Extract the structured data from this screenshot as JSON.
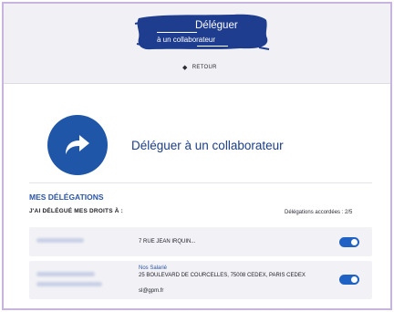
{
  "header": {
    "title_line1": "Déléguer",
    "title_line2": "à un collaborateur",
    "back_label": "RETOUR",
    "brush_color": "#1e3d8f",
    "background_color": "#f1f1f5"
  },
  "hero": {
    "icon": "forward-arrow-icon",
    "title": "Déléguer à un collaborateur",
    "accent_color": "#1f56a8"
  },
  "delegations": {
    "section_title": "MES DÉLÉGATIONS",
    "subtitle": "J'AI DÉLÉGUÉ MES DROITS À :",
    "count_label": "Délégations accordées : 2/5",
    "items": [
      {
        "address": "7 RUE JEAN IRQUIN...",
        "enabled": true
      },
      {
        "company": "Nos Salarié",
        "address": "25 BOULEVARD DE COURCELLES, 75008 CEDEX, PARIS CEDEX",
        "email": "sl@gpm.fr",
        "enabled": true
      }
    ]
  }
}
